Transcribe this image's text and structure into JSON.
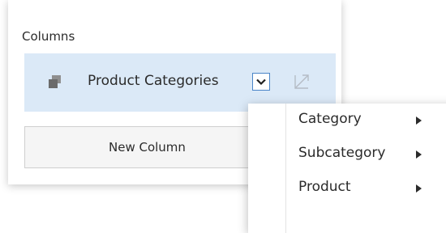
{
  "columns_section": {
    "title": "Columns",
    "item": {
      "label": "Product Categories",
      "icon": "hierarchy-icon",
      "dropdown_icon": "chevron-down-icon",
      "sort_icon": "sort-icon"
    },
    "new_column_label": "New Column"
  },
  "context_menu": {
    "items": [
      {
        "label": "Category",
        "icon": "submenu-arrow-icon"
      },
      {
        "label": "Subcategory",
        "icon": "submenu-arrow-icon"
      },
      {
        "label": "Product",
        "icon": "submenu-arrow-icon"
      }
    ]
  },
  "colors": {
    "item_background": "#dbe9f7",
    "accent_border": "#4a85c8",
    "text": "#2b2b2b"
  }
}
